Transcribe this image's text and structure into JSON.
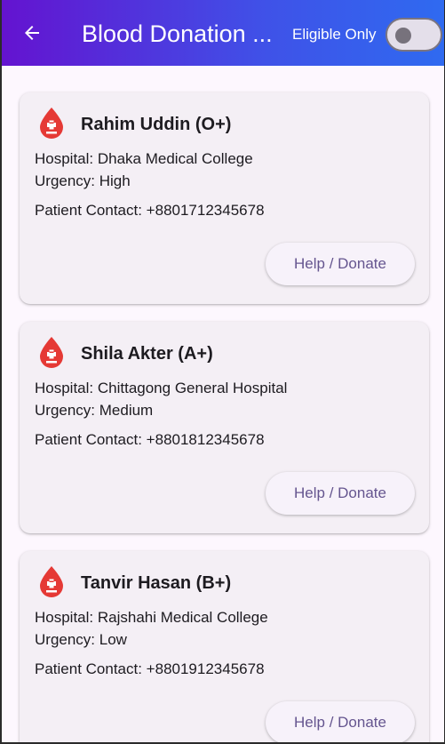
{
  "appbar": {
    "title": "Blood Donation ...",
    "back_icon": "arrow-back-icon",
    "filter_label": "Eligible Only",
    "filter_on": false
  },
  "colors": {
    "appbar_start": "#6413d0",
    "appbar_end": "#2f6af0",
    "drop_red": "#e53935",
    "button_text": "#65558f"
  },
  "requests": [
    {
      "name": "Rahim Uddin (O+)",
      "hospital": "Hospital: Dhaka Medical College",
      "urgency": "Urgency: High",
      "contact": "Patient Contact: +8801712345678",
      "button": "Help / Donate",
      "icon": "blood-drop-icon"
    },
    {
      "name": "Shila Akter (A+)",
      "hospital": "Hospital: Chittagong General Hospital",
      "urgency": "Urgency: Medium",
      "contact": "Patient Contact: +8801812345678",
      "button": "Help / Donate",
      "icon": "blood-drop-icon"
    },
    {
      "name": "Tanvir Hasan (B+)",
      "hospital": "Hospital: Rajshahi Medical College",
      "urgency": "Urgency: Low",
      "contact": "Patient Contact: +8801912345678",
      "button": "Help / Donate",
      "icon": "blood-drop-icon"
    }
  ]
}
